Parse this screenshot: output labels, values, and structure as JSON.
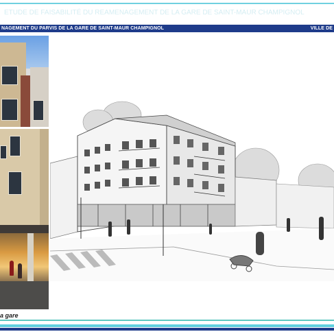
{
  "header": {
    "faint_title": "ETUDE DE FAISABILITÉ DU REAMENAGEMENT DE LA GARE DE SAINT-MAUR CHAMPIGNOL",
    "left_text": "NAGEMENT DU PARVIS DE LA GARE DE SAINT-MAUR CHAMPIGNOL",
    "right_text": "VILLE DE"
  },
  "caption": "a gare",
  "colors": {
    "header_band": "#1e3b8a",
    "accent_cyan": "#5fd0df",
    "accent_teal": "#5cc8c0"
  },
  "illustrations": {
    "left": "photo-collage-station-buildings",
    "right": "architectural-sketch-station-square"
  }
}
